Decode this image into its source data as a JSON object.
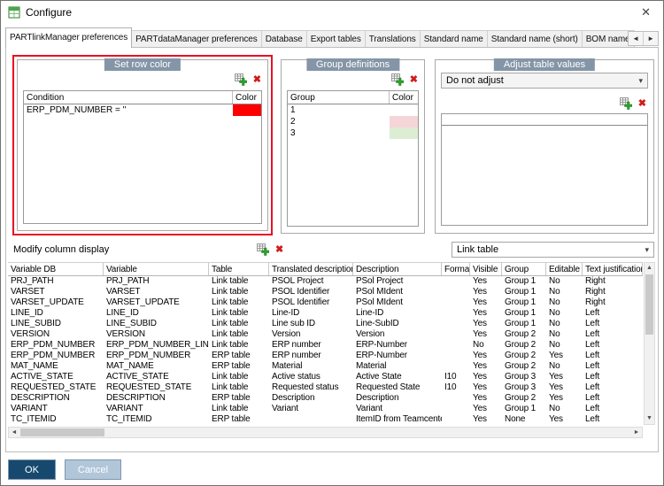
{
  "window": {
    "title": "Configure"
  },
  "glyphs": {
    "close": "✕",
    "up": "▲",
    "down": "▼",
    "left": "◄",
    "right": "►",
    "dropdown": "▾",
    "delete": "✖"
  },
  "tabs": [
    {
      "label": "PARTlinkManager preferences",
      "active": true
    },
    {
      "label": "PARTdataManager preferences",
      "active": false
    },
    {
      "label": "Database",
      "active": false
    },
    {
      "label": "Export tables",
      "active": false
    },
    {
      "label": "Translations",
      "active": false
    },
    {
      "label": "Standard name",
      "active": false
    },
    {
      "label": "Standard name (short)",
      "active": false
    },
    {
      "label": "BOM name",
      "active": false
    }
  ],
  "set_row_color": {
    "title": "Set row color",
    "columns": [
      "Condition",
      "Color"
    ],
    "rows": [
      {
        "condition": "ERP_PDM_NUMBER = ''",
        "color": "#ff0000"
      }
    ]
  },
  "group_definitions": {
    "title": "Group definitions",
    "columns": [
      "Group",
      "Color"
    ],
    "rows": [
      {
        "group": "1",
        "color": "#ffffff"
      },
      {
        "group": "2",
        "color": "#f6d5d8"
      },
      {
        "group": "3",
        "color": "#dcedd4"
      }
    ]
  },
  "adjust_table_values": {
    "title": "Adjust table values",
    "dropdown_value": "Do not adjust"
  },
  "modify_column_display": {
    "title": "Modify column display",
    "table_dropdown_value": "Link table",
    "columns": [
      "Variable DB",
      "Variable",
      "Table",
      "Translated description",
      "Description",
      "Format",
      "Visible",
      "Group",
      "Editable",
      "Text justification"
    ],
    "rows": [
      [
        "PRJ_PATH",
        "PRJ_PATH",
        "Link table",
        "PSOL Project",
        "PSol Project",
        "",
        "Yes",
        "Group 1",
        "No",
        "Right"
      ],
      [
        "VARSET",
        "VARSET",
        "Link table",
        "PSOL Identifier",
        "PSol MIdent",
        "",
        "Yes",
        "Group 1",
        "No",
        "Right"
      ],
      [
        "VARSET_UPDATE",
        "VARSET_UPDATE",
        "Link table",
        "PSOL Identifier",
        "PSol MIdent",
        "",
        "Yes",
        "Group 1",
        "No",
        "Right"
      ],
      [
        "LINE_ID",
        "LINE_ID",
        "Link table",
        "Line-ID",
        "Line-ID",
        "",
        "Yes",
        "Group 1",
        "No",
        "Left"
      ],
      [
        "LINE_SUBID",
        "LINE_SUBID",
        "Link table",
        "Line sub ID",
        "Line-SubID",
        "",
        "Yes",
        "Group 1",
        "No",
        "Left"
      ],
      [
        "VERSION",
        "VERSION",
        "Link table",
        "Version",
        "Version",
        "",
        "Yes",
        "Group 2",
        "No",
        "Left"
      ],
      [
        "ERP_PDM_NUMBER",
        "ERP_PDM_NUMBER_LINKTABLE",
        "Link table",
        "ERP number",
        "ERP-Number",
        "",
        "No",
        "Group 2",
        "No",
        "Left"
      ],
      [
        "ERP_PDM_NUMBER",
        "ERP_PDM_NUMBER",
        "ERP table",
        "ERP number",
        "ERP-Number",
        "",
        "Yes",
        "Group 2",
        "Yes",
        "Left"
      ],
      [
        "MAT_NAME",
        "MAT_NAME",
        "ERP table",
        "Material",
        "Material",
        "",
        "Yes",
        "Group 2",
        "No",
        "Left"
      ],
      [
        "ACTIVE_STATE",
        "ACTIVE_STATE",
        "Link table",
        "Active status",
        "Active State",
        "I10",
        "Yes",
        "Group 3",
        "Yes",
        "Left"
      ],
      [
        "REQUESTED_STATE",
        "REQUESTED_STATE",
        "Link table",
        "Requested status",
        "Requested State",
        "I10",
        "Yes",
        "Group 3",
        "Yes",
        "Left"
      ],
      [
        "DESCRIPTION",
        "DESCRIPTION",
        "ERP table",
        "Description",
        "Description",
        "",
        "Yes",
        "Group 2",
        "Yes",
        "Left"
      ],
      [
        "VARIANT",
        "VARIANT",
        "Link table",
        "Variant",
        "Variant",
        "",
        "Yes",
        "Group 1",
        "No",
        "Left"
      ],
      [
        "TC_ITEMID",
        "TC_ITEMID",
        "ERP table",
        "",
        "ItemID from Teamcenter",
        "",
        "Yes",
        "None",
        "Yes",
        "Left"
      ]
    ]
  },
  "buttons": {
    "ok": "OK",
    "cancel": "Cancel"
  },
  "colors": {
    "highlight_red": "#e81123",
    "group_title_bg": "#8495a7",
    "ok_bg": "#17496e",
    "cancel_bg": "#b2c6da",
    "swatch_red": "#ff0000"
  }
}
